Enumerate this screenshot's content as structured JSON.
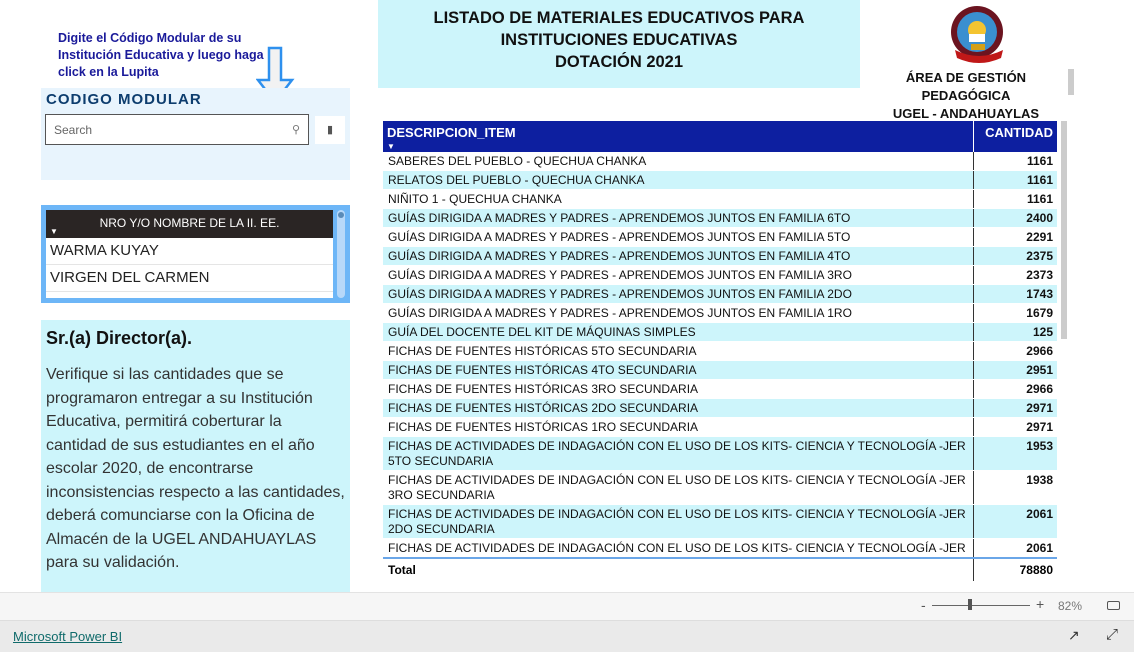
{
  "instructions": "Digite el Código Modular de su Institución Educativa y luego haga click en la Lupita",
  "code_filter": {
    "title": "CODIGO MODULAR",
    "search_placeholder": "Search",
    "search_icon": "search-icon",
    "clear_icon": "eraser-icon"
  },
  "school_slicer": {
    "header": "NRO Y/O NOMBRE DE LA II. EE.",
    "items": [
      "WARMA KUYAY",
      "VIRGEN DEL CARMEN"
    ]
  },
  "director": {
    "title": "Sr.(a) Director(a).",
    "text": "Verifique si las cantidades que se programaron entregar a su Institución Educativa, permitirá coberturar la cantidad de sus estudiantes en el año escolar 2020, de encontrarse inconsistencias respecto a las cantidades, deberá comunciarse con la Oficina de Almacén de la UGEL ANDAHUAYLAS para su validación."
  },
  "header": {
    "title_lines": [
      "LISTADO DE MATERIALES EDUCATIVOS PARA",
      "INSTITUCIONES EDUCATIVAS",
      "DOTACIÓN 2021"
    ],
    "area_lines": [
      "ÁREA DE GESTIÓN PEDAGÓGICA",
      "UGEL - ANDAHUAYLAS"
    ],
    "logo_text": "UGEL ANDAHUAYLAS"
  },
  "table": {
    "columns": [
      "DESCRIPCION_ITEM",
      "CANTIDAD"
    ],
    "rows": [
      [
        "SABERES DEL PUEBLO - QUECHUA CHANKA",
        "1161"
      ],
      [
        "RELATOS DEL PUEBLO - QUECHUA CHANKA",
        "1161"
      ],
      [
        "NIÑITO 1 - QUECHUA CHANKA",
        "1161"
      ],
      [
        "GUÍAS DIRIGIDA A MADRES Y PADRES - APRENDEMOS JUNTOS EN FAMILIA 6TO",
        "2400"
      ],
      [
        "GUÍAS DIRIGIDA A MADRES Y PADRES - APRENDEMOS JUNTOS EN FAMILIA 5TO",
        "2291"
      ],
      [
        "GUÍAS DIRIGIDA A MADRES Y PADRES - APRENDEMOS JUNTOS EN FAMILIA 4TO",
        "2375"
      ],
      [
        "GUÍAS DIRIGIDA A MADRES Y PADRES - APRENDEMOS JUNTOS EN FAMILIA 3RO",
        "2373"
      ],
      [
        "GUÍAS DIRIGIDA A MADRES Y PADRES - APRENDEMOS JUNTOS EN FAMILIA 2DO",
        "1743"
      ],
      [
        "GUÍAS DIRIGIDA A MADRES Y PADRES - APRENDEMOS JUNTOS EN FAMILIA 1RO",
        "1679"
      ],
      [
        "GUÍA DEL DOCENTE DEL KIT DE MÁQUINAS SIMPLES",
        "125"
      ],
      [
        "FICHAS DE FUENTES HISTÓRICAS 5TO SECUNDARIA",
        "2966"
      ],
      [
        "FICHAS DE FUENTES HISTÓRICAS 4TO SECUNDARIA",
        "2951"
      ],
      [
        "FICHAS DE FUENTES HISTÓRICAS 3RO SECUNDARIA",
        "2966"
      ],
      [
        "FICHAS DE FUENTES HISTÓRICAS 2DO SECUNDARIA",
        "2971"
      ],
      [
        "FICHAS DE FUENTES HISTÓRICAS 1RO SECUNDARIA",
        "2971"
      ],
      [
        "FICHAS DE ACTIVIDADES DE INDAGACIÓN CON EL USO DE LOS KITS- CIENCIA Y TECNOLOGÍA -JER 5TO SECUNDARIA",
        "1953"
      ],
      [
        "FICHAS DE ACTIVIDADES DE INDAGACIÓN CON EL USO DE LOS KITS- CIENCIA Y TECNOLOGÍA -JER 3RO SECUNDARIA",
        "1938"
      ],
      [
        "FICHAS DE ACTIVIDADES DE INDAGACIÓN CON EL USO DE LOS KITS- CIENCIA Y TECNOLOGÍA -JER 2DO SECUNDARIA",
        "2061"
      ],
      [
        "FICHAS DE ACTIVIDADES DE INDAGACIÓN CON EL USO DE LOS KITS- CIENCIA Y TECNOLOGÍA -JER",
        "2061"
      ]
    ],
    "total_label": "Total",
    "total_value": "78880"
  },
  "zoom": {
    "minus": "-",
    "plus": "+",
    "level": "82%",
    "level_percent": 82
  },
  "footer": {
    "link": "Microsoft Power BI",
    "share_icon": "share-icon",
    "fullscreen_icon": "expand-icon"
  },
  "colors": {
    "header_blue": "#0d1fa0",
    "light_cyan": "#cdf5fb",
    "instruction_blue": "#1a1a9a"
  }
}
